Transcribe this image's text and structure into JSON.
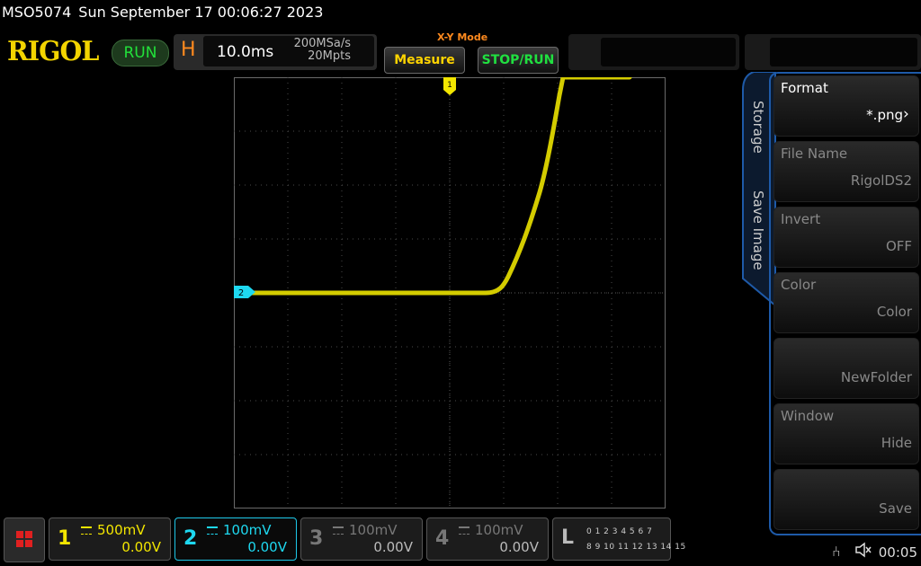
{
  "title": {
    "model": "MSO5074",
    "datetime": "Sun September 17 00:06:27 2023"
  },
  "brand": "RIGOL",
  "status": "RUN",
  "horizontal": {
    "letter": "H",
    "timebase": "10.0ms",
    "sample_rate": "200MSa/s",
    "memory_depth": "20Mpts"
  },
  "mode_label": "X-Y Mode",
  "buttons": {
    "measure": "Measure",
    "stop_run": "STOP/RUN"
  },
  "markers": {
    "trigger": "1",
    "ch2": "2"
  },
  "side_tabs": {
    "storage": "Storage",
    "save_image": "Save Image"
  },
  "menu": [
    {
      "label": "Format",
      "value": "*.png",
      "active": true
    },
    {
      "label": "File Name",
      "value": "RigolDS2",
      "active": false
    },
    {
      "label": "Invert",
      "value": "OFF",
      "active": false
    },
    {
      "label": "Color",
      "value": "Color",
      "active": false
    },
    {
      "label": "",
      "value": "NewFolder",
      "active": false
    },
    {
      "label": "Window",
      "value": "Hide",
      "active": false
    },
    {
      "label": "",
      "value": "Save",
      "active": false
    }
  ],
  "channels": [
    {
      "num": "1",
      "scale": "500mV",
      "offset": "0.00V",
      "color": "#f3e600"
    },
    {
      "num": "2",
      "scale": "100mV",
      "offset": "0.00V",
      "color": "#1ed8f0"
    },
    {
      "num": "3",
      "scale": "100mV",
      "offset": "0.00V",
      "color": "#777777"
    },
    {
      "num": "4",
      "scale": "100mV",
      "offset": "0.00V",
      "color": "#777777"
    }
  ],
  "logic": {
    "letter": "L",
    "row1": "0 1 2 3   4 5 6 7",
    "row2": "8 9 10 11 12 13 14 15"
  },
  "clock": "00:05",
  "colors": {
    "trace": "#d8d000",
    "grid": "#555555",
    "accent": "#1e5aa8"
  }
}
